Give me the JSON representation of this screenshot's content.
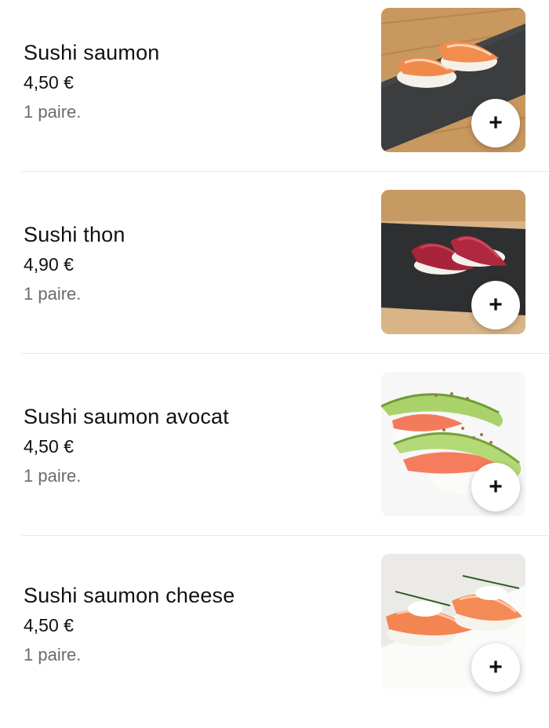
{
  "menu": {
    "items": [
      {
        "title": "Sushi saumon",
        "price": "4,50 €",
        "description": "1 paire.",
        "image_icon": "sushi-saumon-image",
        "add_label": "+"
      },
      {
        "title": "Sushi thon",
        "price": "4,90 €",
        "description": "1 paire.",
        "image_icon": "sushi-thon-image",
        "add_label": "+"
      },
      {
        "title": "Sushi saumon avocat",
        "price": "4,50 €",
        "description": "1 paire.",
        "image_icon": "sushi-saumon-avocat-image",
        "add_label": "+"
      },
      {
        "title": "Sushi saumon cheese",
        "price": "4,50 €",
        "description": "1 paire.",
        "image_icon": "sushi-saumon-cheese-image",
        "add_label": "+"
      }
    ]
  },
  "colors": {
    "text": "#111111",
    "secondary_text": "#6b6b6b",
    "divider": "#e8e8e8",
    "button_bg": "#ffffff"
  }
}
